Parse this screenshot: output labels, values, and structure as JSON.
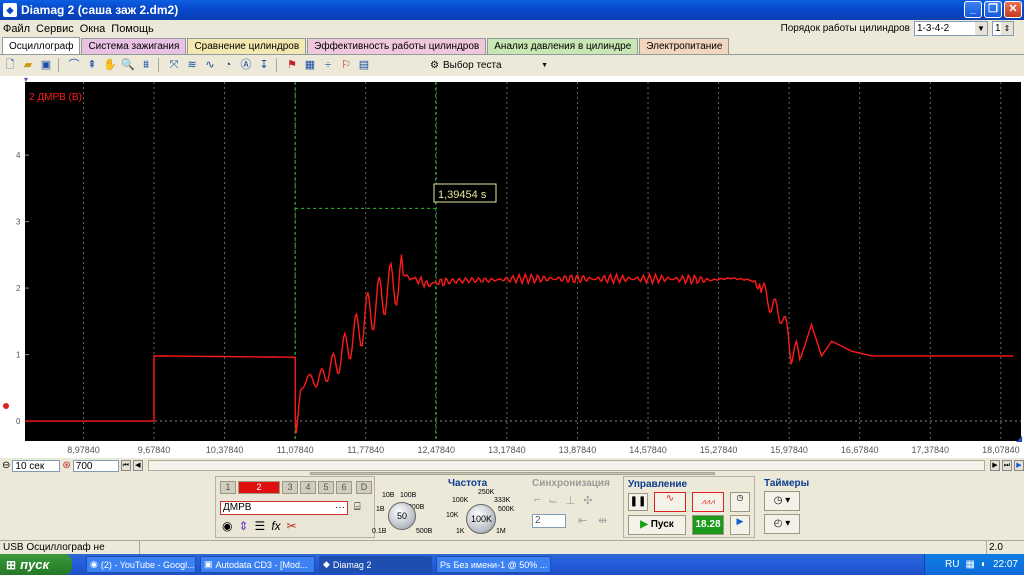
{
  "window": {
    "title": "Diamag 2 (саша заж 2.dm2)",
    "buttons": [
      "minimize-icon",
      "maximize-icon",
      "close-icon"
    ]
  },
  "menu": {
    "items": [
      "Файл",
      "Сервис",
      "Окна",
      "Помощь"
    ],
    "cylinder_order_label": "Порядок работы цилиндров",
    "cylinder_order_value": "1-3-4-2",
    "cylinder_count_value": "1"
  },
  "tabs": [
    {
      "label": "Осциллограф",
      "color": "#FFFFFF"
    },
    {
      "label": "Система зажигания",
      "color": "#E9C2E3"
    },
    {
      "label": "Сравнение цилиндров",
      "color": "#F3E8B0"
    },
    {
      "label": "Эффективность работы цилиндров",
      "color": "#F0C8DC"
    },
    {
      "label": "Анализ давления в цилиндре",
      "color": "#C8E7B4"
    },
    {
      "label": "Электропитание",
      "color": "#F3D6C0"
    }
  ],
  "toolbar": {
    "test_select_label": "Выбор теста"
  },
  "scope": {
    "channel_label": "2 ДМРВ (В)",
    "cursor_readout": "1,39454 s",
    "colors": {
      "background": "#000000",
      "trace": "#FF1A1A",
      "grid": "#6A6A6A",
      "cursor": "#2EBE2E",
      "readout": "#E8E8A0"
    }
  },
  "chart_data": {
    "type": "line",
    "ylabel": "2 ДМРВ (В)",
    "y_ticks": [
      "1",
      "2",
      "3",
      "4"
    ],
    "ylim": [
      -0.3,
      5.1
    ],
    "xlim": [
      8.3984,
      18.2784
    ],
    "x_ticks": [
      "8,97840",
      "9,67840",
      "10,37840",
      "11,07840",
      "11,77840",
      "12,47840",
      "13,17840",
      "13,87840",
      "14,57840",
      "15,27840",
      "15,97840",
      "16,67840",
      "17,37840",
      "18,07840"
    ],
    "cursors_x": [
      11.0784,
      12.473
    ],
    "cursor_readout": "1,39454 s",
    "series": [
      {
        "x": [
          8.3984,
          9.6784,
          9.6784,
          10.3784,
          11.0784,
          11.0784,
          11.09,
          11.13,
          11.2,
          11.3,
          11.4,
          11.5,
          11.6,
          11.7,
          11.8,
          11.9,
          12.0,
          12.1,
          12.15,
          12.2,
          12.3,
          12.4,
          12.473,
          12.6,
          12.8,
          13.0,
          13.3,
          13.6,
          14.0,
          14.4,
          14.8,
          15.2,
          15.4,
          15.6,
          15.7,
          15.8,
          15.9,
          15.97,
          16.0,
          16.05,
          16.1,
          16.2,
          16.3,
          16.4,
          16.6,
          16.8,
          17.0,
          17.4,
          17.8,
          18.2
        ],
        "y": [
          0.0,
          0.0,
          0.98,
          0.97,
          0.96,
          0.05,
          -0.18,
          0.45,
          0.65,
          0.6,
          0.75,
          0.9,
          1.15,
          1.35,
          1.6,
          1.8,
          2.0,
          2.1,
          2.2,
          2.16,
          2.12,
          2.05,
          2.08,
          2.1,
          2.12,
          2.12,
          2.14,
          2.14,
          2.14,
          2.14,
          2.14,
          2.12,
          2.15,
          2.12,
          2.0,
          1.75,
          1.6,
          1.3,
          1.0,
          1.05,
          0.98,
          1.45,
          0.98,
          1.2,
          1.05,
          0.98,
          0.98,
          0.98,
          0.98,
          0.98
        ]
      }
    ]
  },
  "controls": {
    "time_scale": "10 сек",
    "points_value": "700",
    "channel_buttons": [
      "1",
      "2",
      "3",
      "4",
      "5",
      "6",
      "D"
    ],
    "active_channel": "2",
    "channel_name": "ДМРВ",
    "voltage_knob": {
      "center": "50",
      "labels": [
        "10В",
        "100В",
        "1В",
        "200В",
        "0.1В",
        "500В"
      ]
    },
    "frequency_title": "Частота",
    "frequency_knob": {
      "center": "100K",
      "labels": [
        "250K",
        "100K",
        "333K",
        "10K",
        "500K",
        "1K",
        "1M"
      ]
    },
    "sync_title": "Синхронизация",
    "sync_channel": "2",
    "control_title": "Управление",
    "start_label": "Пуск",
    "timer_value": "18.28",
    "timers_title": "Таймеры"
  },
  "status": {
    "left": "USB Осциллограф не подключен",
    "right": "2.0"
  },
  "taskbar": {
    "start_label": "пуск",
    "tasks": [
      "(2) - YouTube - Googl...",
      "Autodata CD3 - [Mod...",
      "Diamag 2",
      "Без имени-1 @ 50% ..."
    ],
    "active_task": "Diamag 2",
    "tray_lang": "RU",
    "clock": "22:07"
  }
}
